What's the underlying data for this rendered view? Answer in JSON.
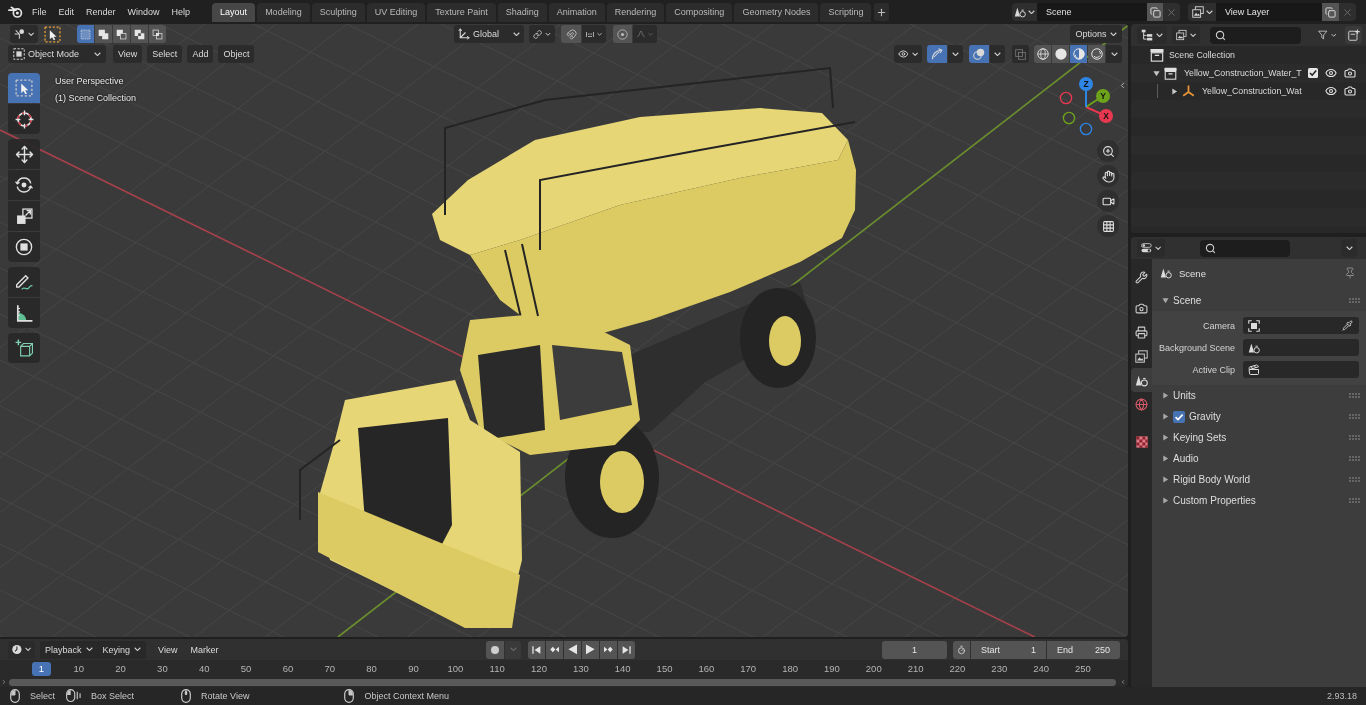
{
  "topbar": {
    "menus": [
      "File",
      "Edit",
      "Render",
      "Window",
      "Help"
    ],
    "workspaces": [
      {
        "label": "Layout",
        "selected": true
      },
      {
        "label": "Modeling",
        "selected": false
      },
      {
        "label": "Sculpting",
        "selected": false
      },
      {
        "label": "UV Editing",
        "selected": false
      },
      {
        "label": "Texture Paint",
        "selected": false
      },
      {
        "label": "Shading",
        "selected": false
      },
      {
        "label": "Animation",
        "selected": false
      },
      {
        "label": "Rendering",
        "selected": false
      },
      {
        "label": "Compositing",
        "selected": false
      },
      {
        "label": "Geometry Nodes",
        "selected": false
      },
      {
        "label": "Scripting",
        "selected": false
      }
    ],
    "scene": "Scene",
    "view_layer": "View Layer"
  },
  "viewport": {
    "tool_header": {
      "select_modes": [
        {
          "kind": "set",
          "selected": true
        },
        {
          "kind": "extend",
          "selected": false
        },
        {
          "kind": "subtract",
          "selected": false
        },
        {
          "kind": "difference",
          "selected": false
        },
        {
          "kind": "intersect",
          "selected": false
        }
      ],
      "orientation": "Global",
      "options": "Options"
    },
    "header": {
      "mode": "Object Mode",
      "menus": [
        "View",
        "Select",
        "Add",
        "Object"
      ],
      "gizmos_on": true,
      "overlays_on": true,
      "xray_on": false,
      "shading": [
        {
          "kind": "wireframe",
          "selected": false
        },
        {
          "kind": "solid",
          "selected": false
        },
        {
          "kind": "material",
          "selected": true
        },
        {
          "kind": "rendered",
          "selected": false
        }
      ]
    },
    "overlay_text": [
      "User Perspective",
      "(1) Scene Collection"
    ],
    "tool_groups": [
      {
        "tools": [
          {
            "kind": "select_box",
            "selected": true
          },
          {
            "kind": "cursor",
            "selected": false
          }
        ]
      },
      {
        "tools": [
          {
            "kind": "move",
            "selected": false
          },
          {
            "kind": "rotate",
            "selected": false
          },
          {
            "kind": "scale",
            "selected": false
          },
          {
            "kind": "transform",
            "selected": false
          }
        ]
      },
      {
        "tools": [
          {
            "kind": "annotate",
            "selected": false
          },
          {
            "kind": "measure",
            "selected": false
          }
        ]
      },
      {
        "tools": [
          {
            "kind": "add_cube",
            "selected": false
          }
        ]
      }
    ],
    "gizmo_axes": [
      {
        "label": "X",
        "color": "#e8384f"
      },
      {
        "label": "Y",
        "color": "#6da31b"
      },
      {
        "label": "Z",
        "color": "#2f85e3"
      }
    ]
  },
  "outliner": {
    "root": "Scene Collection",
    "items": [
      {
        "kind": "collection",
        "label": "Yellow_Construction_Water_T",
        "expanded": true,
        "checked": true,
        "children": [
          {
            "kind": "object",
            "label": "Yellow_Construction_Wat",
            "expanded": false
          }
        ]
      }
    ]
  },
  "properties": {
    "tabs": [
      {
        "kind": "tool",
        "selected": false
      },
      {
        "kind": "render",
        "selected": false
      },
      {
        "kind": "output",
        "selected": false
      },
      {
        "kind": "view_layer",
        "selected": false
      },
      {
        "kind": "scene",
        "selected": true
      },
      {
        "kind": "world",
        "selected": false
      },
      {
        "kind": "texture",
        "selected": false
      }
    ],
    "context": "Scene",
    "panels": [
      {
        "title": "Scene",
        "expanded": true,
        "fields": [
          {
            "kind": "camera",
            "label": "Camera"
          },
          {
            "kind": "scene",
            "label": "Background Scene"
          },
          {
            "kind": "clip",
            "label": "Active Clip"
          }
        ]
      },
      {
        "title": "Units",
        "expanded": false
      },
      {
        "title": "Gravity",
        "expanded": false,
        "toggle": {
          "checked": true
        }
      },
      {
        "title": "Keying Sets",
        "expanded": false
      },
      {
        "title": "Audio",
        "expanded": false
      },
      {
        "title": "Rigid Body World",
        "expanded": false
      },
      {
        "title": "Custom Properties",
        "expanded": false
      }
    ]
  },
  "timeline": {
    "menus": [
      {
        "kind": "dropdown",
        "label": "Playback"
      },
      {
        "kind": "dropdown",
        "label": "Keying"
      },
      {
        "kind": "menu",
        "label": "View"
      },
      {
        "kind": "menu",
        "label": "Marker"
      }
    ],
    "current_frame": "1",
    "start": {
      "label": "Start",
      "value": "1"
    },
    "end": {
      "label": "End",
      "value": "250"
    },
    "ruler": [
      {
        "label": "1",
        "selected": true
      },
      {
        "label": "10",
        "selected": false
      },
      {
        "label": "20",
        "selected": false
      },
      {
        "label": "30",
        "selected": false
      },
      {
        "label": "40",
        "selected": false
      },
      {
        "label": "50",
        "selected": false
      },
      {
        "label": "60",
        "selected": false
      },
      {
        "label": "70",
        "selected": false
      },
      {
        "label": "80",
        "selected": false
      },
      {
        "label": "90",
        "selected": false
      },
      {
        "label": "100",
        "selected": false
      },
      {
        "label": "110",
        "selected": false
      },
      {
        "label": "120",
        "selected": false
      },
      {
        "label": "130",
        "selected": false
      },
      {
        "label": "140",
        "selected": false
      },
      {
        "label": "150",
        "selected": false
      },
      {
        "label": "160",
        "selected": false
      },
      {
        "label": "170",
        "selected": false
      },
      {
        "label": "180",
        "selected": false
      },
      {
        "label": "190",
        "selected": false
      },
      {
        "label": "200",
        "selected": false
      },
      {
        "label": "210",
        "selected": false
      },
      {
        "label": "220",
        "selected": false
      },
      {
        "label": "230",
        "selected": false
      },
      {
        "label": "240",
        "selected": false
      },
      {
        "label": "250",
        "selected": false
      }
    ]
  },
  "status_bar": {
    "hints": [
      {
        "kind": "left_click",
        "label": "Select"
      },
      {
        "kind": "drag",
        "label": "Box Select"
      },
      {
        "kind": "middle_click",
        "label": "Rotate View"
      },
      {
        "kind": "right_click",
        "label": "Object Context Menu"
      }
    ],
    "version": "2.93.18"
  }
}
